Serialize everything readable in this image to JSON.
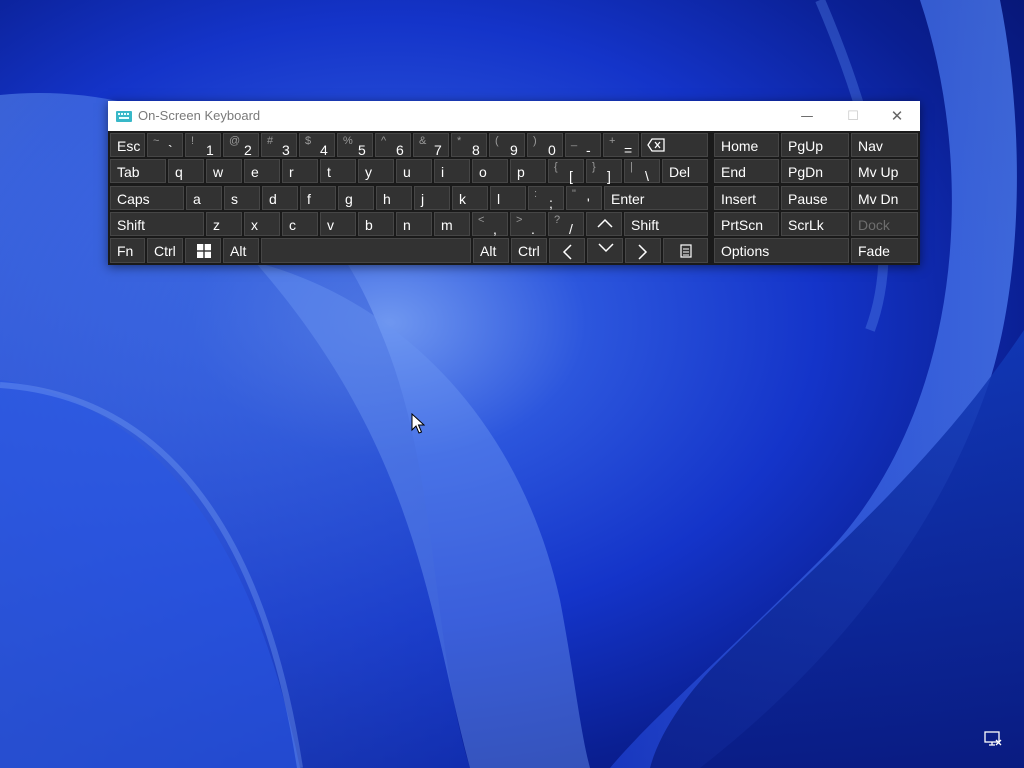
{
  "window": {
    "title": "On-Screen Keyboard",
    "controls": {
      "minimize": "—",
      "maximize": "☐",
      "close": "✕"
    }
  },
  "rows": {
    "r1": {
      "esc": "Esc",
      "symbols": [
        {
          "sec": "~",
          "pri": "`"
        },
        {
          "sec": "!",
          "pri": "1"
        },
        {
          "sec": "@",
          "pri": "2"
        },
        {
          "sec": "#",
          "pri": "3"
        },
        {
          "sec": "$",
          "pri": "4"
        },
        {
          "sec": "%",
          "pri": "5"
        },
        {
          "sec": "^",
          "pri": "6"
        },
        {
          "sec": "&",
          "pri": "7"
        },
        {
          "sec": "*",
          "pri": "8"
        },
        {
          "sec": "(",
          "pri": "9"
        },
        {
          "sec": ")",
          "pri": "0"
        },
        {
          "sec": "_",
          "pri": "-"
        },
        {
          "sec": "+",
          "pri": "="
        }
      ]
    },
    "r2": {
      "tab": "Tab",
      "letters": [
        "q",
        "w",
        "e",
        "r",
        "t",
        "y",
        "u",
        "i",
        "o",
        "p"
      ],
      "symbols": [
        {
          "sec": "{",
          "pri": "["
        },
        {
          "sec": "}",
          "pri": "]"
        },
        {
          "sec": "|",
          "pri": "\\"
        }
      ],
      "del": "Del"
    },
    "r3": {
      "caps": "Caps",
      "letters": [
        "a",
        "s",
        "d",
        "f",
        "g",
        "h",
        "j",
        "k",
        "l"
      ],
      "symbols": [
        {
          "sec": ":",
          "pri": ";"
        },
        {
          "sec": "\"",
          "pri": "'"
        }
      ],
      "enter": "Enter"
    },
    "r4": {
      "shift_left": "Shift",
      "letters": [
        "z",
        "x",
        "c",
        "v",
        "b",
        "n",
        "m"
      ],
      "symbols": [
        {
          "sec": "<",
          "pri": ","
        },
        {
          "sec": ">",
          "pri": "."
        },
        {
          "sec": "?",
          "pri": "/"
        }
      ],
      "shift_right": "Shift"
    },
    "r5": {
      "fn": "Fn",
      "ctrl_left": "Ctrl",
      "alt_left": "Alt",
      "alt_right": "Alt",
      "ctrl_right": "Ctrl"
    }
  },
  "nav": {
    "home": "Home",
    "pgup": "PgUp",
    "nav": "Nav",
    "end": "End",
    "pgdn": "PgDn",
    "mvup": "Mv Up",
    "insert": "Insert",
    "pause": "Pause",
    "mvdn": "Mv Dn",
    "prtscn": "PrtScn",
    "scrlk": "ScrLk",
    "dock": "Dock",
    "options": "Options",
    "fade": "Fade"
  },
  "icons": [
    "keyboard-app-icon",
    "backspace-icon",
    "windows-logo-icon",
    "arrow-up-icon",
    "arrow-left-icon",
    "arrow-down-icon",
    "arrow-right-icon",
    "menu-key-icon",
    "network-icon",
    "mouse-cursor-icon"
  ],
  "colors": {
    "key_bg": "#323232",
    "keyboard_bg": "#1a1a1a",
    "titlebar_bg": "#ffffff",
    "muted_text": "#6e6e6e"
  }
}
